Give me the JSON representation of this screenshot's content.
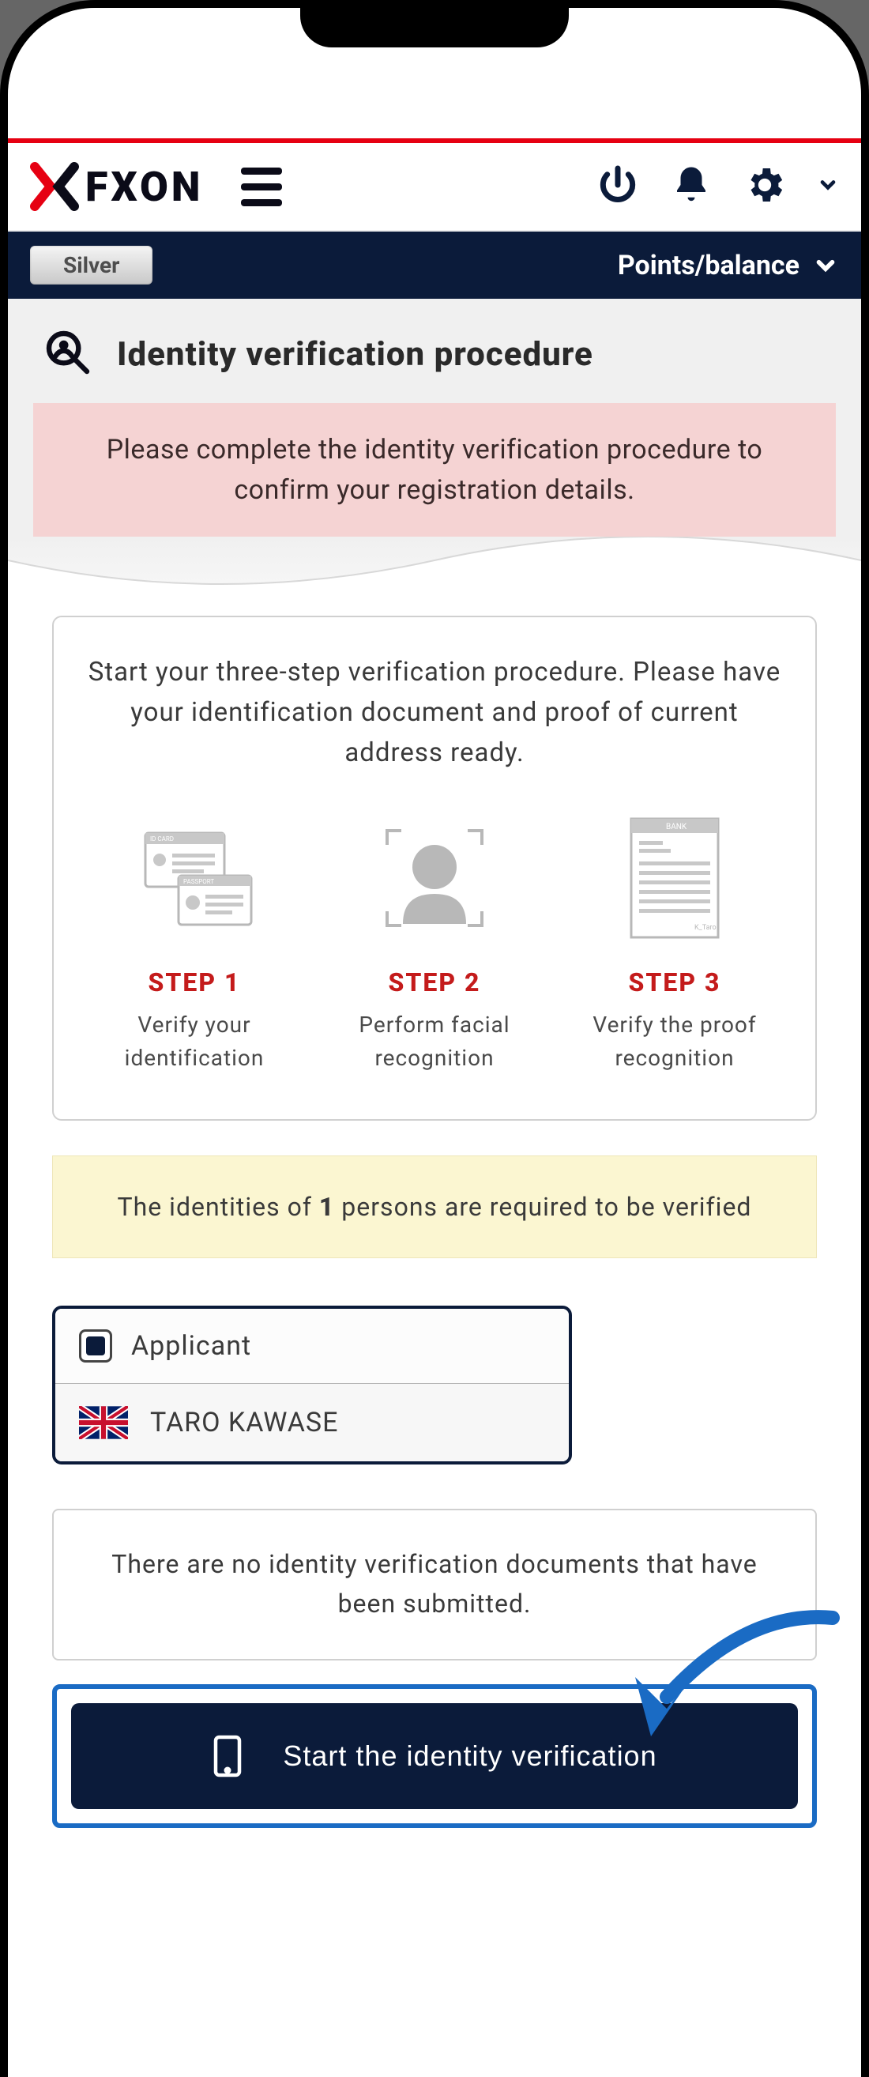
{
  "header": {
    "logo_text": "FXON",
    "tier": "Silver",
    "points_label": "Points/balance"
  },
  "page": {
    "title": "Identity verification procedure",
    "notice": "Please complete the identity verification procedure to confirm your registration details."
  },
  "steps": {
    "intro": "Start your three-step verification procedure. Please have your identification document and proof of current address ready.",
    "items": [
      {
        "label": "STEP 1",
        "desc": "Verify your identification"
      },
      {
        "label": "STEP 2",
        "desc": "Perform facial recognition"
      },
      {
        "label": "STEP 3",
        "desc": "Verify the proof recognition"
      }
    ]
  },
  "required_banner": {
    "prefix": "The identities of ",
    "count": "1",
    "suffix": " persons are required to be verified"
  },
  "applicant": {
    "role": "Applicant",
    "name": "TARO KAWASE"
  },
  "docs": {
    "none_text": "There are no identity verification documents that have been submitted."
  },
  "cta": {
    "label": "Start the identity verification"
  }
}
